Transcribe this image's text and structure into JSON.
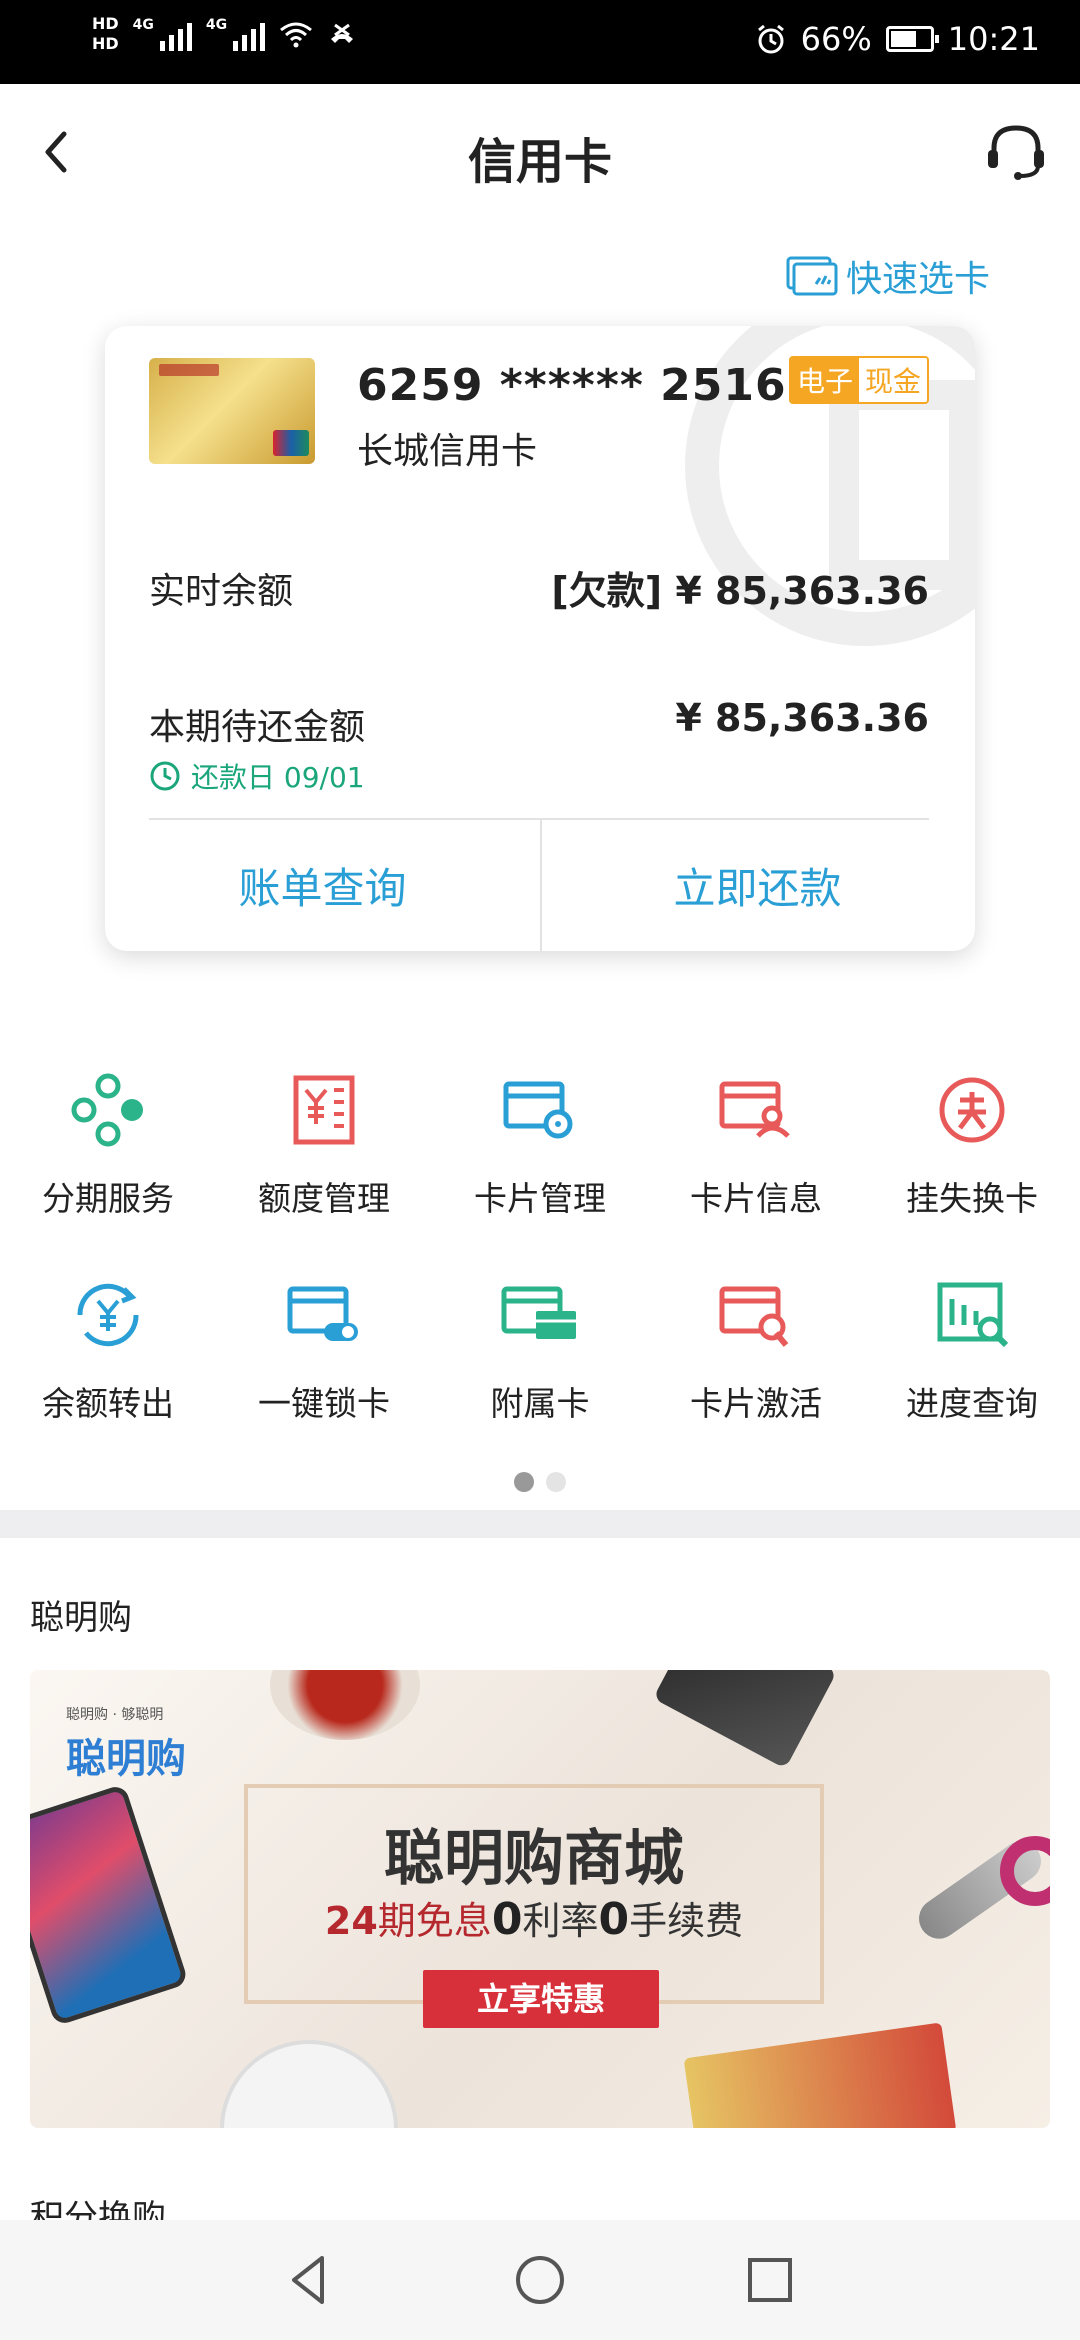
{
  "status_bar": {
    "hd1": "HD",
    "hd2": "HD",
    "net1": "4G",
    "net2": "4G",
    "battery": "66%",
    "battery_level": 0.66,
    "time": "10:21"
  },
  "header": {
    "title": "信用卡"
  },
  "quick_select": "快速选卡",
  "card": {
    "number": "6259 ****** 2516",
    "name": "长城信用卡",
    "ecash_tag": [
      "电子",
      "现金"
    ],
    "balance_label": "实时余额",
    "balance_value": "[欠款] ¥ 85,363.36",
    "due_label": "本期待还金额",
    "due_value": "¥ 85,363.36",
    "due_date": "还款日 09/01",
    "btn_bill": "账单查询",
    "btn_repay": "立即还款"
  },
  "services": [
    {
      "label": "分期服务",
      "icon": "installment-icon",
      "color": "#2bb38a"
    },
    {
      "label": "额度管理",
      "icon": "credit-limit-icon",
      "color": "#e85a5a"
    },
    {
      "label": "卡片管理",
      "icon": "card-settings-icon",
      "color": "#2a9fd6"
    },
    {
      "label": "卡片信息",
      "icon": "card-info-icon",
      "color": "#e85a5a"
    },
    {
      "label": "挂失换卡",
      "icon": "report-loss-icon",
      "color": "#e85a5a"
    },
    {
      "label": "余额转出",
      "icon": "balance-transfer-icon",
      "color": "#2a9fd6"
    },
    {
      "label": "一键锁卡",
      "icon": "lock-card-icon",
      "color": "#2a9fd6"
    },
    {
      "label": "附属卡",
      "icon": "supplementary-card-icon",
      "color": "#2bb38a"
    },
    {
      "label": "卡片激活",
      "icon": "activate-card-icon",
      "color": "#e85a5a"
    },
    {
      "label": "进度查询",
      "icon": "progress-query-icon",
      "color": "#2bb38a"
    }
  ],
  "pager": {
    "pages": 2,
    "active": 1
  },
  "smart_buy": {
    "section_title": "聪明购",
    "banner": {
      "logo_small": "聪明购 · 够聪明",
      "logo": "聪明购",
      "title": "聪明购商城",
      "sub_24": "24",
      "sub_a": "期免息",
      "sub_0a": "0",
      "sub_b": "利率",
      "sub_0b": "0",
      "sub_c": "手续费",
      "button": "立享特惠"
    }
  },
  "points_section_title": "积分换购",
  "colors": {
    "accent": "#2a9fd6",
    "green": "#1aa67a",
    "orange": "#f5a623",
    "red": "#d8303a"
  }
}
